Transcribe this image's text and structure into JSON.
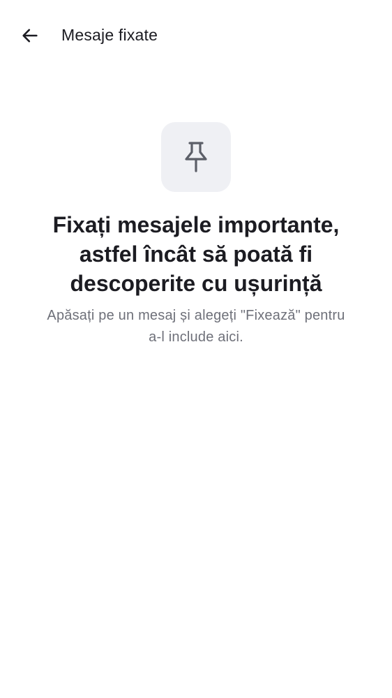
{
  "header": {
    "back_icon": "arrow-left-icon",
    "title": "Mesaje fixate"
  },
  "empty_state": {
    "icon": "pin-icon",
    "headline": "Fixați mesajele importante, astfel încât să poată fi descoperite cu ușurință",
    "description": "Apăsați pe un mesaj și alegeți \"Fixează\" pentru a-l include aici."
  },
  "colors": {
    "background": "#ffffff",
    "text_primary": "#1c1c22",
    "text_secondary": "#6e7079",
    "icon_tile": "#eff0f4",
    "icon": "#5c5f68"
  }
}
